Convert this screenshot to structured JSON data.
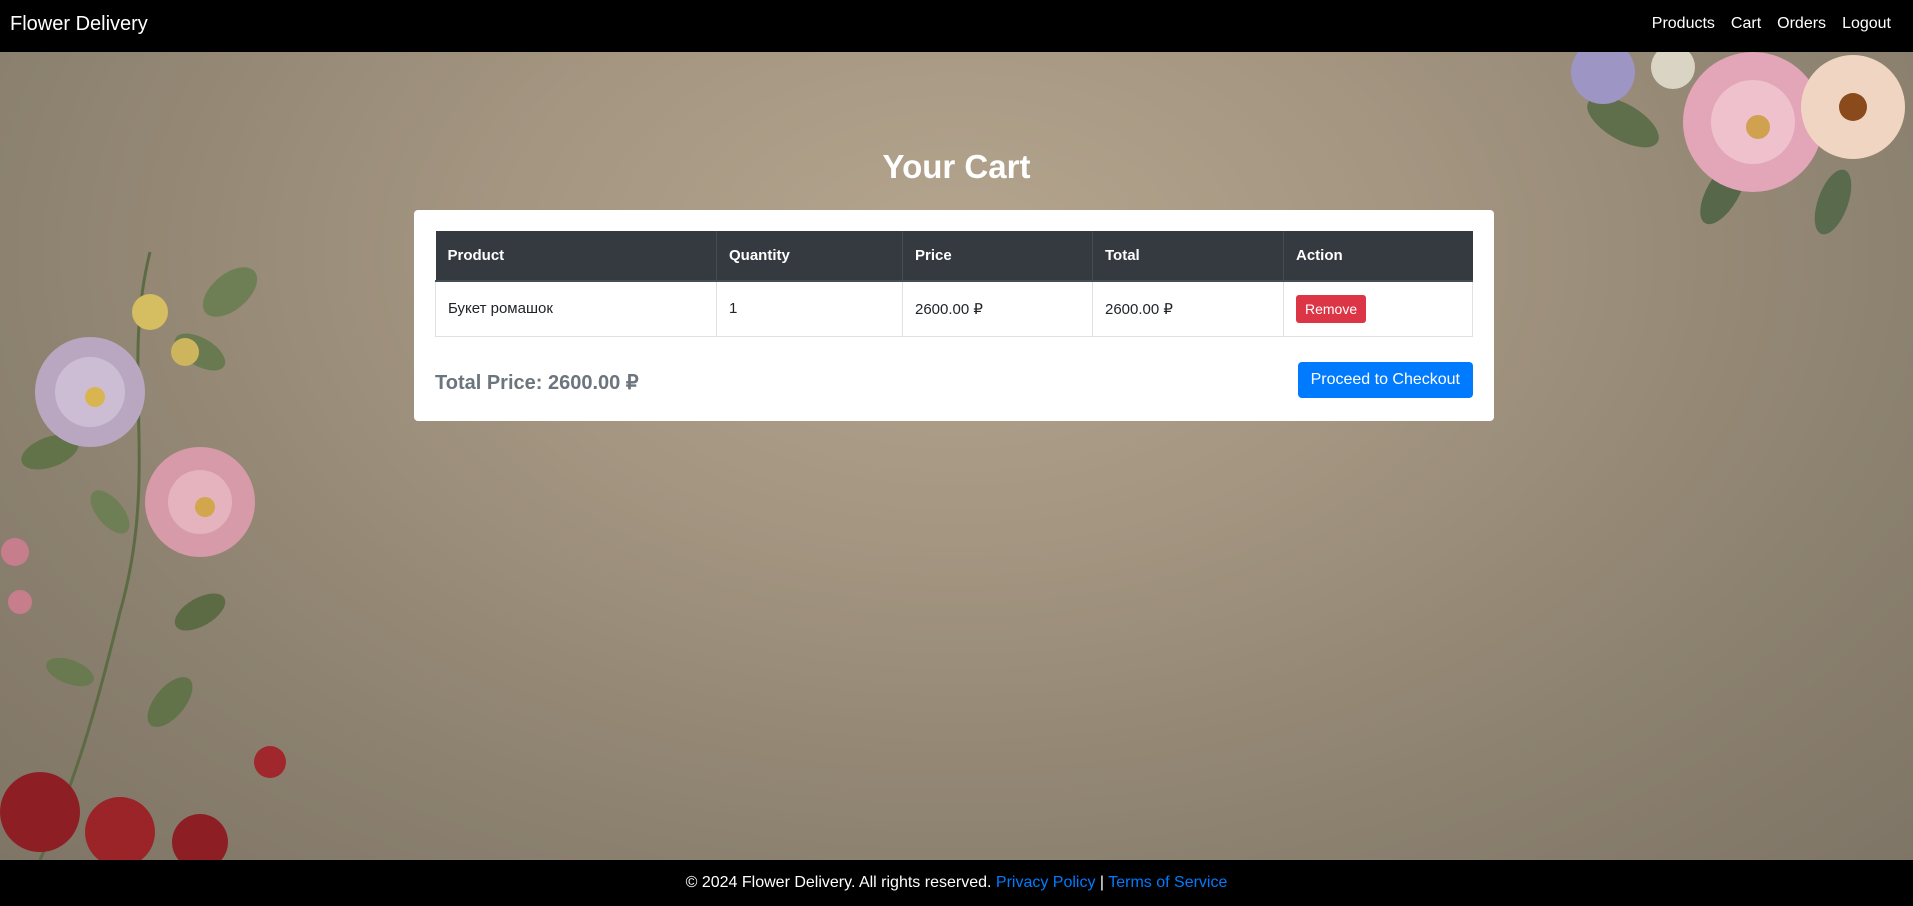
{
  "navbar": {
    "brand": "Flower Delivery",
    "links": [
      "Products",
      "Cart",
      "Orders",
      "Logout"
    ]
  },
  "page": {
    "title": "Your Cart"
  },
  "cart": {
    "columns": [
      "Product",
      "Quantity",
      "Price",
      "Total",
      "Action"
    ],
    "rows": [
      {
        "product": "Букет ромашок",
        "quantity": "1",
        "price": "2600.00 ₽",
        "total": "2600.00 ₽",
        "action": "Remove"
      }
    ],
    "total_label": "Total Price: 2600.00 ₽",
    "checkout_label": "Proceed to Checkout"
  },
  "footer": {
    "copyright": "© 2024 Flower Delivery. All rights reserved.",
    "privacy": "Privacy Policy",
    "separator": "|",
    "terms": "Terms of Service"
  },
  "colors": {
    "navbar": "#000000",
    "table_header": "#343a40",
    "remove_button": "#dc3545",
    "checkout_button": "#007bff",
    "link": "#007bff"
  }
}
